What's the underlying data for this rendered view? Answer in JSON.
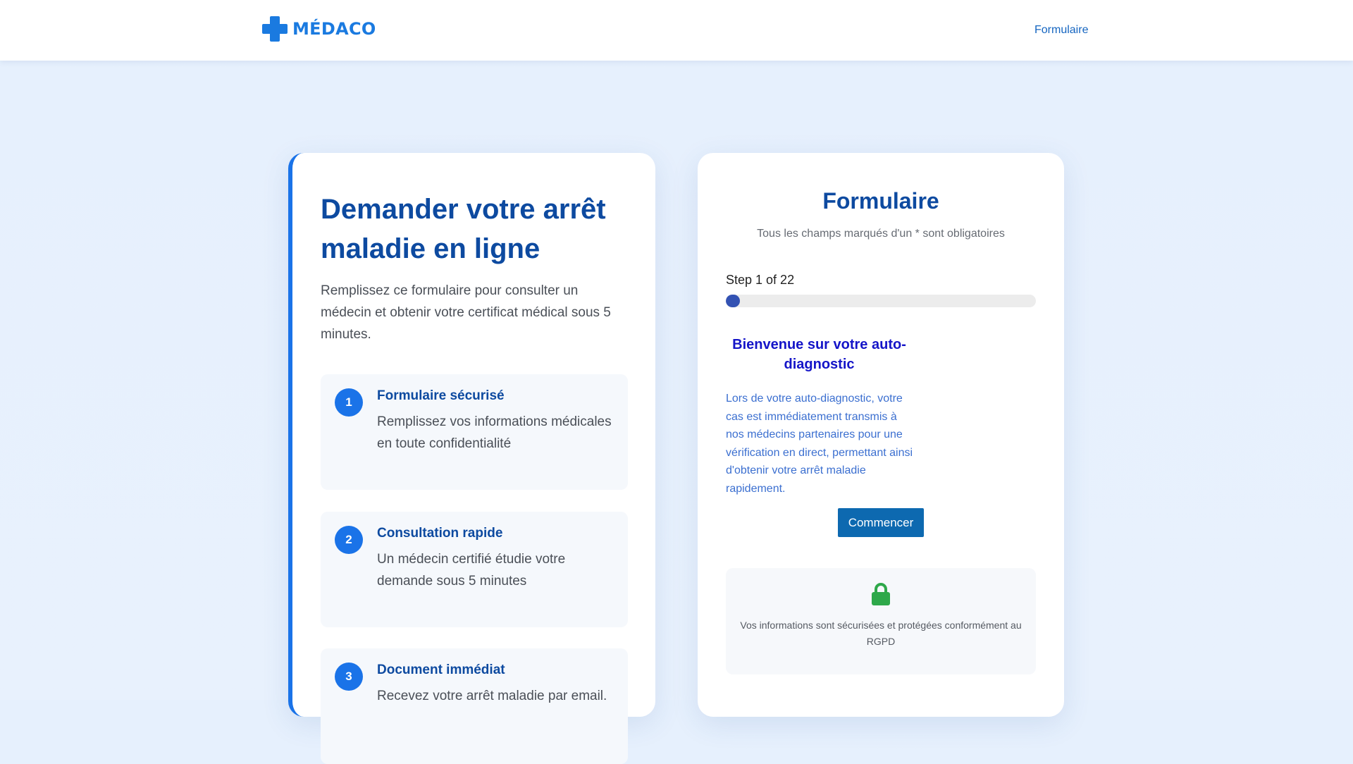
{
  "header": {
    "logo_text": "MÉDACO",
    "nav_link": "Formulaire"
  },
  "colors": {
    "brand": "#1a7ae0",
    "heading": "#0d4aa0",
    "accent_border": "#1a73e8",
    "progress": "#3352b3",
    "button": "#0d69b0",
    "lock": "#2ea84a"
  },
  "icons": {
    "logo": "medical-cross-icon",
    "secure": "lock-icon"
  },
  "hero": {
    "title": "Demander votre arrêt maladie en ligne",
    "description": "Remplissez ce formulaire pour consulter un médecin et obtenir votre certificat médical sous 5 minutes."
  },
  "features": [
    {
      "number": "1",
      "title": "Formulaire sécurisé",
      "description": "Remplissez vos informations médicales en toute confidentialité"
    },
    {
      "number": "2",
      "title": "Consultation rapide",
      "description": "Un médecin certifié étudie votre demande sous 5 minutes"
    },
    {
      "number": "3",
      "title": "Document immédiat",
      "description": "Recevez votre arrêt maladie par email."
    }
  ],
  "form": {
    "title": "Formulaire",
    "subtitle": "Tous les champs marqués d'un * sont obligatoires",
    "step_label": "Step 1 of 22",
    "progress": {
      "current": 1,
      "total": 22
    },
    "welcome_title": "Bienvenue sur votre auto-diagnostic",
    "welcome_text": "Lors de votre auto-diagnostic, votre cas est immédiatement transmis à nos médecins partenaires pour une vérification en direct, permettant ainsi d'obtenir votre arrêt maladie rapidement.",
    "start_button": "Commencer",
    "secure_text": "Vos informations sont sécurisées et protégées conformément au RGPD"
  }
}
